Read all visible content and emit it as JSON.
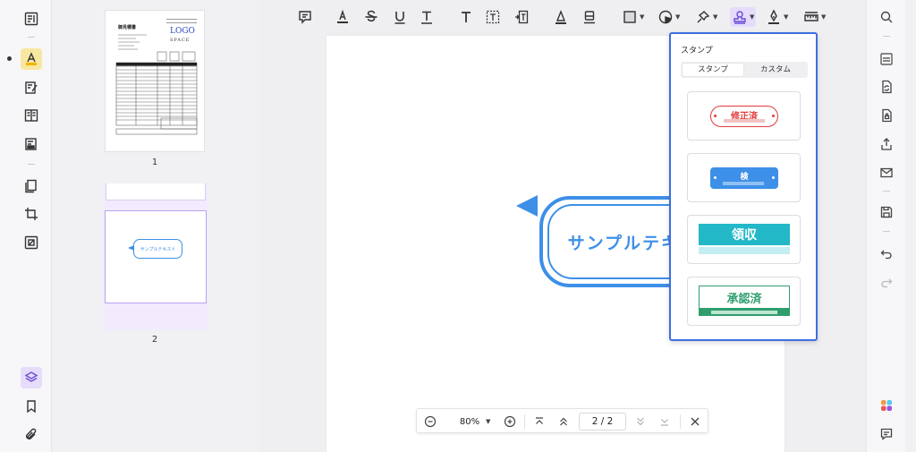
{
  "thumbnails": [
    {
      "page": "1",
      "doc_title": "御見積書",
      "logo_line1": "LOGO",
      "logo_line2": "SPACE"
    },
    {
      "page": "2",
      "callout_text": "サンプルテキスト"
    }
  ],
  "page_content": {
    "callout_text": "サンプルテキスト"
  },
  "stamp_panel": {
    "title": "スタンプ",
    "tabs": [
      {
        "label": "スタンプ",
        "active": true
      },
      {
        "label": "カスタム",
        "active": false
      }
    ],
    "stamps": [
      {
        "label": "修正済",
        "color": "#e03b3b"
      },
      {
        "label": "検",
        "color": "#3d8fe8"
      },
      {
        "label": "領収",
        "color": "#22b8c8"
      },
      {
        "label": "承認済",
        "color": "#2f9e6e"
      }
    ]
  },
  "navigation": {
    "zoom": "80%",
    "page_indicator": "2 / 2"
  },
  "colors": {
    "accent": "#3d8fe8",
    "panel_border": "#3d6fe0",
    "active_tool": "#e5dcfb",
    "highlight_tool": "#f8e7a0"
  }
}
